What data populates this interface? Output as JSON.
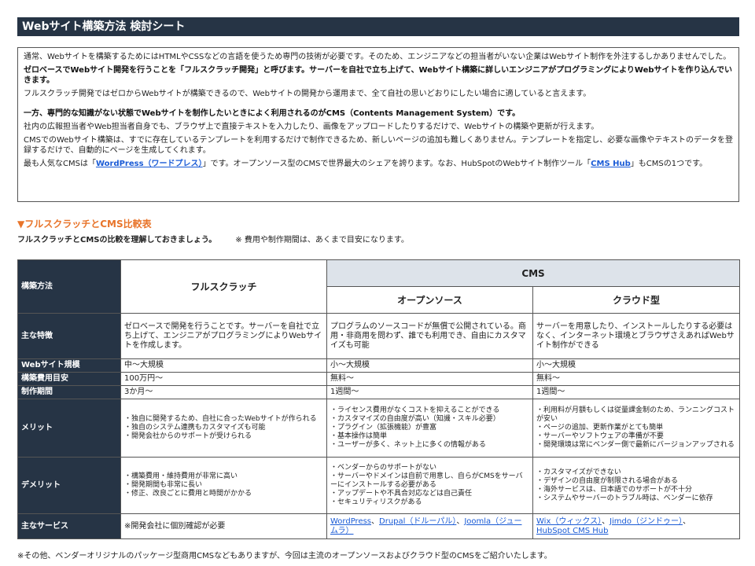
{
  "title": "Webサイト構築方法 検討シート",
  "intro": {
    "p1": "通常、Webサイトを構築するためにはHTMLやCSSなどの言語を使うため専門の技術が必要です。そのため、エンジニアなどの担当者がいない企業はWebサイト制作を外注するしかありませんでした。",
    "p2": "ゼロベースでWebサイト開発を行うことを「フルスクラッチ開発」と呼びます。サーバーを自社で立ち上げて、Webサイト構築に詳しいエンジニアがプログラミングによりWebサイトを作り込んでいきます。",
    "p3": "フルスクラッチ開発ではゼロからWebサイトが構築できるので、Webサイトの開発から運用まで、全て自社の思いどおりにしたい場合に適していると言えます。",
    "p4": "一方、専門的な知識がない状態でWebサイトを制作したいときによく利用されるのがCMS（Contents Management System）です。",
    "p5": "社内の広報担当者やWeb担当者自身でも、ブラウザ上で直接テキストを入力したり、画像をアップロードしたりするだけで、Webサイトの構築や更新が行えます。",
    "p6": "CMSでのWebサイト構築は、すでに存在しているテンプレートを利用するだけで制作できるため、新しいページの追加も難しくありません。テンプレートを指定し、必要な画像やテキストのデータを登録するだけで、自動的にページを生成してくれます。",
    "p7_a": "最も人気なCMSは「",
    "p7_link1": "WordPress（ワードプレス）",
    "p7_b": "」です。オープンソース型のCMSで世界最大のシェアを誇ります。なお、HubSpotのWebサイト制作ツール「",
    "p7_link2": "CMS Hub",
    "p7_c": "」もCMSの1つです。"
  },
  "section": {
    "heading": "▼フルスクラッチとCMS比較表",
    "sub": "フルスクラッチとCMSの比較を理解しておきましょう。",
    "note": "※ 費用や制作期間は、あくまで目安になります。"
  },
  "table": {
    "h_method": "構築方法",
    "h_fullscratch": "フルスクラッチ",
    "h_cms": "CMS",
    "h_opensource": "オープンソース",
    "h_cloud": "クラウド型",
    "r_feature": {
      "label": "主な特徴",
      "fs": "ゼロベースで開発を行うことです。サーバーを自社で立ち上げて、エンジニアがプログラミングによりWebサイトを作成します。",
      "os": "プログラムのソースコードが無償で公開されている。商用・非商用を問わず、誰でも利用でき、自由にカスタマイズも可能",
      "cl": "サーバーを用意したり、インストールしたりする必要はなく、インターネット環境とブラウザさえあればWebサイト制作ができる"
    },
    "r_scale": {
      "label": "Webサイト規模",
      "fs": "中〜大規模",
      "os": "小〜大規模",
      "cl": "小〜大規模"
    },
    "r_cost": {
      "label": "構築費用目安",
      "fs": "100万円〜",
      "os": "無料〜",
      "cl": "無料〜"
    },
    "r_period": {
      "label": "制作期間",
      "fs": "3か月〜",
      "os": "1週間〜",
      "cl": "1週間〜"
    },
    "r_merit": {
      "label": "メリット",
      "fs": [
        "・独自に開発するため、自社に合ったWebサイトが作られる",
        "・独自のシステム連携もカスタマイズも可能",
        "・開発会社からのサポートが受けられる"
      ],
      "os": [
        "・ライセンス費用がなくコストを抑えることができる",
        "・カスタマイズの自由度が高い（知識・スキル必要）",
        "・プラグイン（拡張機能）が豊富",
        "・基本操作は簡単",
        "・ユーザーが多く、ネット上に多くの情報がある"
      ],
      "cl": [
        "・利用料が月額もしくは従量課金制のため、ランニングコストが安い",
        "・ページの追加、更新作業がとても簡単",
        "・サーバーやソフトウェアの準備が不要",
        "・開発環境は常にベンダー側で最新にバージョンアップされる"
      ]
    },
    "r_demerit": {
      "label": "デメリット",
      "fs": [
        "・構築費用・維持費用が非常に高い",
        "・開発期間も非常に長い",
        "・修正、改良ごとに費用と時間がかかる"
      ],
      "os": [
        "・ベンダーからのサポートがない",
        "・サーバーやドメインは自前で用意し、自らがCMSをサーバーにインストールする必要がある",
        "・アップデートや不具合対応などは自己責任",
        "・セキュリティリスクがある"
      ],
      "cl": [
        "・カスタマイズができない",
        "・デザインの自由度が制限される場合がある",
        "・海外サービスは、日本語でのサポートが不十分",
        "・システムやサーバーのトラブル時は、ベンダーに依存"
      ]
    },
    "r_service": {
      "label": "主なサービス",
      "fs": "※開発会社に個別確認が必要",
      "os_links": [
        "WordPress",
        "Drupal（ドルーパル）",
        "Joomla（ジュームラ）"
      ],
      "os_sep": "、",
      "cl_links": [
        "Wix（ウィックス）",
        "Jimdo（ジンドゥー）",
        "HubSpot CMS Hub"
      ],
      "cl_sep": "、"
    }
  },
  "footnote": "※その他、ベンダーオリジナルのパッケージ型商用CMSなどもありますが、今回は主流のオープンソースおよびクラウド型のCMSをご紹介いたします。"
}
